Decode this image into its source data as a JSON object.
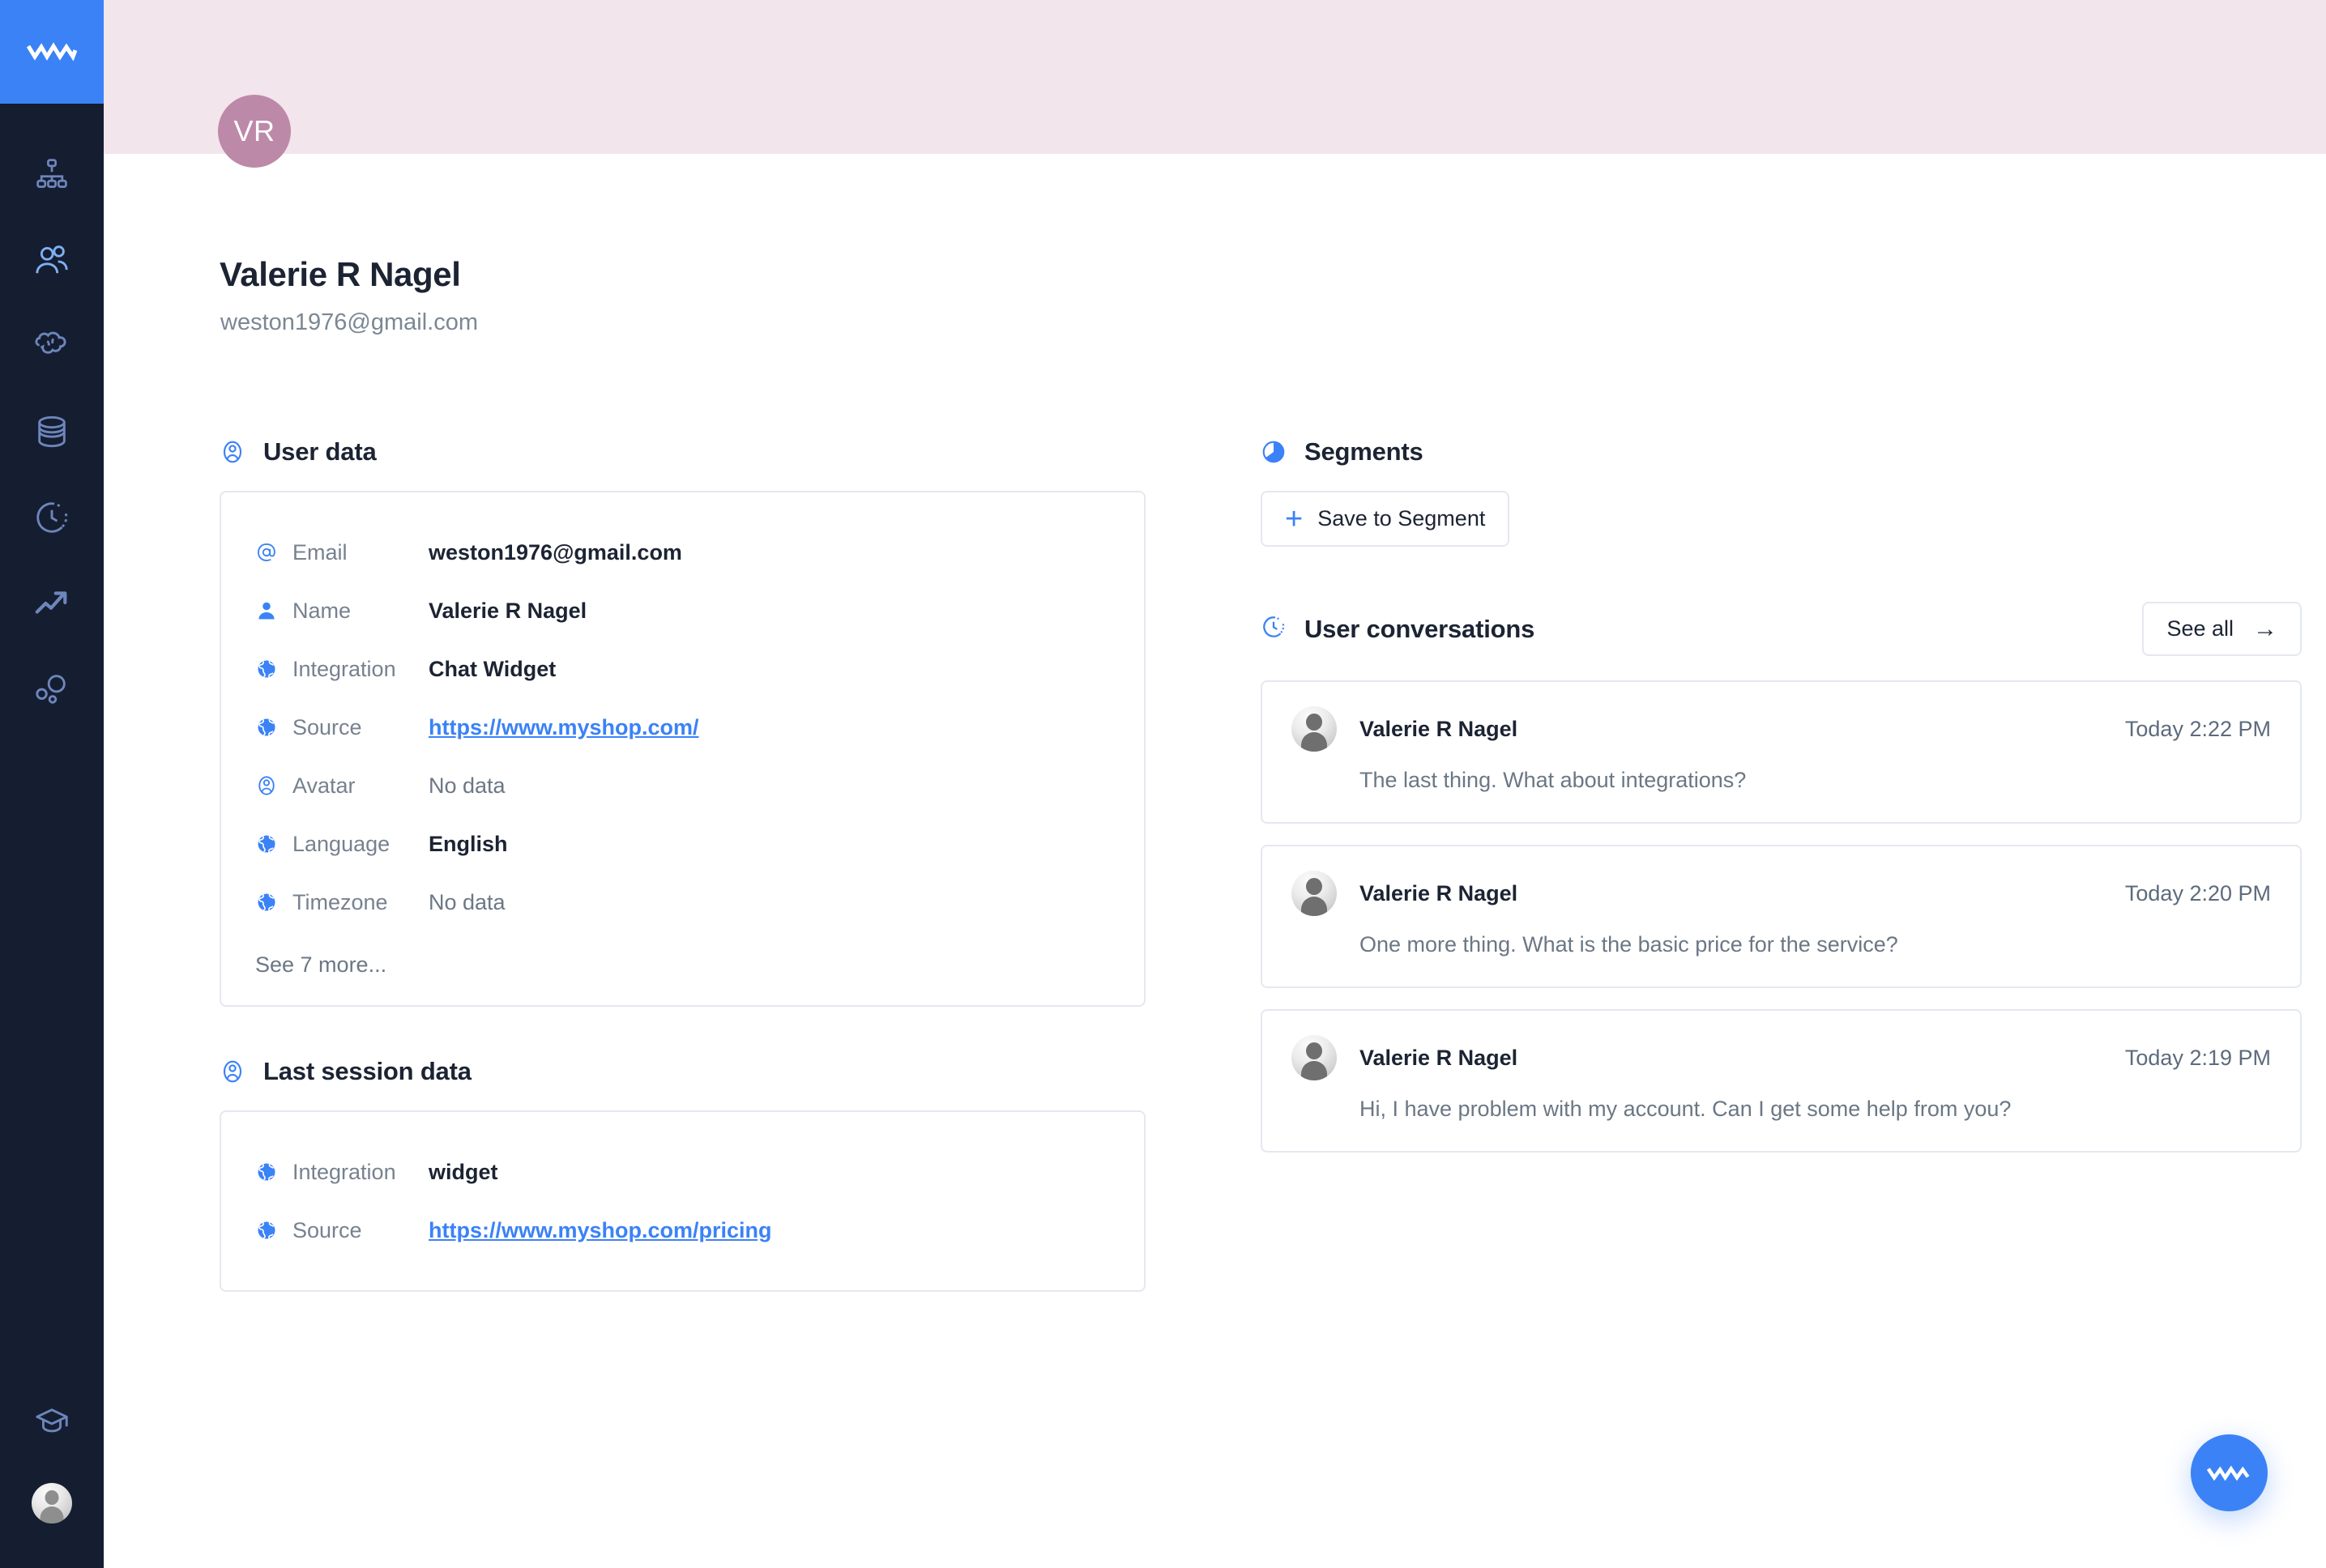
{
  "colors": {
    "accent": "#3b82f6",
    "sidebar_bg": "#151d30",
    "banner_bg": "#f2e5ec",
    "avatar_bg": "#bd89a8",
    "card_border": "#e4e8ef",
    "text_primary": "#1c2433",
    "text_muted": "#6b7784"
  },
  "sidebar": {
    "logo": "wave-logo",
    "items": [
      {
        "icon": "org-chart-icon",
        "name": "sidebar-item-org-chart"
      },
      {
        "icon": "users-icon",
        "name": "sidebar-item-users"
      },
      {
        "icon": "chat-bubble-icon",
        "name": "sidebar-item-chats"
      },
      {
        "icon": "database-icon",
        "name": "sidebar-item-data"
      },
      {
        "icon": "clock-history-icon",
        "name": "sidebar-item-history"
      },
      {
        "icon": "trending-up-icon",
        "name": "sidebar-item-analytics"
      },
      {
        "icon": "bubbles-icon",
        "name": "sidebar-item-segments"
      }
    ],
    "bottom_items": [
      {
        "icon": "graduation-cap-icon",
        "name": "sidebar-item-academy"
      },
      {
        "icon": "user-avatar-icon",
        "name": "sidebar-item-account"
      }
    ]
  },
  "profile": {
    "initials": "VR",
    "name": "Valerie R Nagel",
    "email": "weston1976@gmail.com"
  },
  "user_data": {
    "section_title": "User data",
    "section_icon": "user-circle-icon",
    "rows": [
      {
        "icon": "at-sign-icon",
        "key": "Email",
        "value": "weston1976@gmail.com",
        "type": "text"
      },
      {
        "icon": "person-icon",
        "key": "Name",
        "value": "Valerie R Nagel",
        "type": "text"
      },
      {
        "icon": "globe-icon",
        "key": "Integration",
        "value": "Chat Widget",
        "type": "text"
      },
      {
        "icon": "globe-icon",
        "key": "Source",
        "value": "https://www.myshop.com/",
        "type": "link"
      },
      {
        "icon": "user-circle-icon",
        "key": "Avatar",
        "value": "No data",
        "type": "muted"
      },
      {
        "icon": "globe-icon",
        "key": "Language",
        "value": "English",
        "type": "text"
      },
      {
        "icon": "globe-icon",
        "key": "Timezone",
        "value": "No data",
        "type": "muted"
      }
    ],
    "see_more_label": "See 7 more..."
  },
  "last_session": {
    "section_title": "Last session data",
    "section_icon": "user-circle-icon",
    "rows": [
      {
        "icon": "globe-icon",
        "key": "Integration",
        "value": "widget",
        "type": "text"
      },
      {
        "icon": "globe-icon",
        "key": "Source",
        "value": "https://www.myshop.com/pricing",
        "type": "link"
      }
    ]
  },
  "segments": {
    "section_title": "Segments",
    "section_icon": "pie-chart-icon",
    "save_button_label": "Save to Segment"
  },
  "conversations": {
    "section_title": "User conversations",
    "section_icon": "clock-history-icon",
    "see_all_label": "See all",
    "items": [
      {
        "name": "Valerie R Nagel",
        "time": "Today 2:22 PM",
        "message": "The last thing. What about integrations?"
      },
      {
        "name": "Valerie R Nagel",
        "time": "Today 2:20 PM",
        "message": "One more thing. What is the basic price for the service?"
      },
      {
        "name": "Valerie R Nagel",
        "time": "Today 2:19 PM",
        "message": "Hi, I have problem with my account. Can I get some help from you?"
      }
    ]
  },
  "fab": {
    "icon": "wave-logo"
  }
}
